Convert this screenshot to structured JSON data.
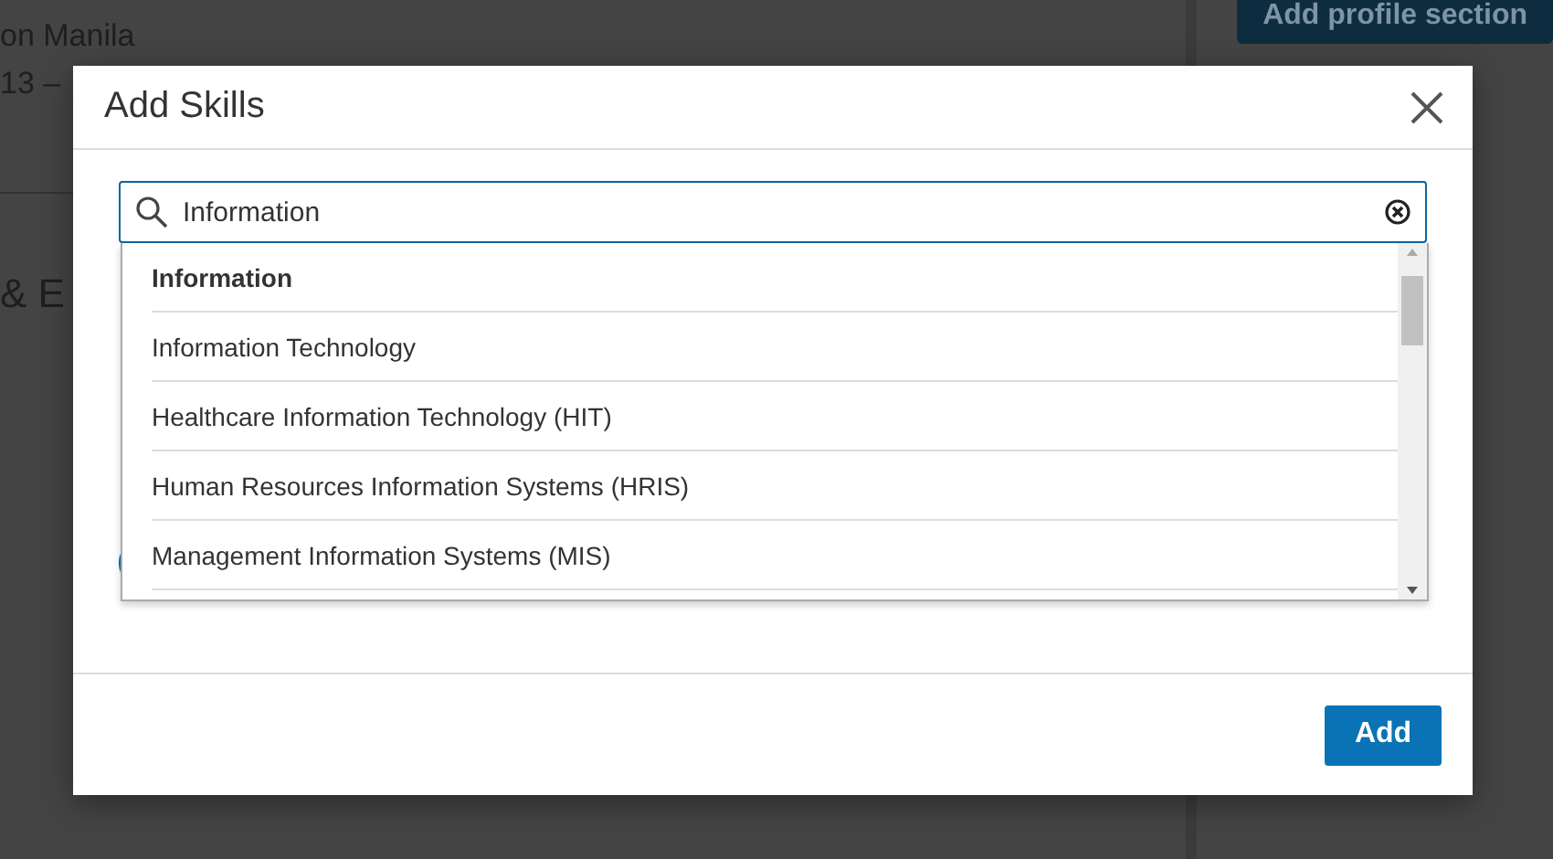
{
  "background": {
    "location": "on Manila",
    "dates": "13 –",
    "section_heading": "& E",
    "add_section_button": "Add profile section"
  },
  "dialog": {
    "title": "Add Skills",
    "search": {
      "value": "Information"
    },
    "suggestions": [
      {
        "label": "Information",
        "kind": "query"
      },
      {
        "label": "Information Technology",
        "kind": "suggestion"
      },
      {
        "label": "Healthcare Information Technology (HIT)",
        "kind": "suggestion"
      },
      {
        "label": "Human Resources Information Systems (HRIS)",
        "kind": "suggestion"
      },
      {
        "label": "Management Information Systems (MIS)",
        "kind": "suggestion"
      }
    ],
    "add_button": "Add"
  }
}
